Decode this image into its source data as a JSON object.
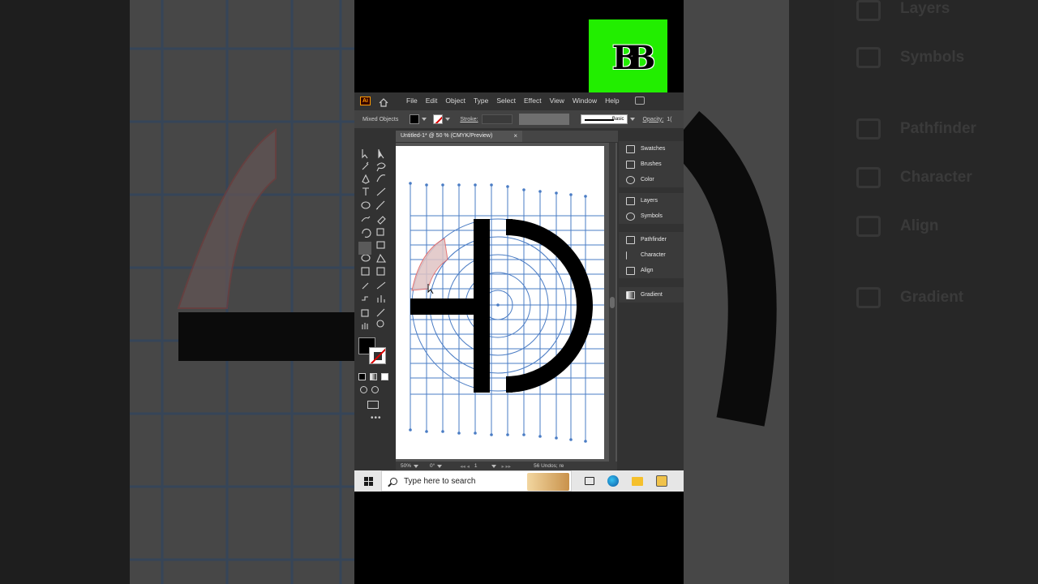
{
  "logo": {
    "text": "BB"
  },
  "menubar": {
    "app_badge": "Ai",
    "items": [
      "File",
      "Edit",
      "Object",
      "Type",
      "Select",
      "Effect",
      "View",
      "Window",
      "Help"
    ]
  },
  "control_bar": {
    "selection": "Mixed Objects",
    "stroke_label": "Stroke:",
    "brush": "Basic",
    "opacity_label": "Opacity:",
    "opacity_value": "1("
  },
  "document": {
    "tab_title": "Untitled-1* @ 50 % (CMYK/Preview)",
    "close": "×"
  },
  "status_bar": {
    "zoom": "50%",
    "rotation": "0°",
    "artboard": "1",
    "undos": "56 Undos; re"
  },
  "panels": {
    "group1": [
      "Swatches",
      "Brushes",
      "Color"
    ],
    "group2": [
      "Layers",
      "Symbols"
    ],
    "group3": [
      "Pathfinder",
      "Character",
      "Align"
    ],
    "group4": [
      "Gradient"
    ]
  },
  "taskbar": {
    "search_placeholder": "Type here to search"
  },
  "background_panels": [
    "Layers",
    "Symbols",
    "Pathfinder",
    "Character",
    "Align",
    "Gradient"
  ],
  "colors": {
    "logo_bg": "#22ee00",
    "grid": "#4a7cc4",
    "selection_fill": "#d9b3b3",
    "ui_dark": "#323232"
  }
}
